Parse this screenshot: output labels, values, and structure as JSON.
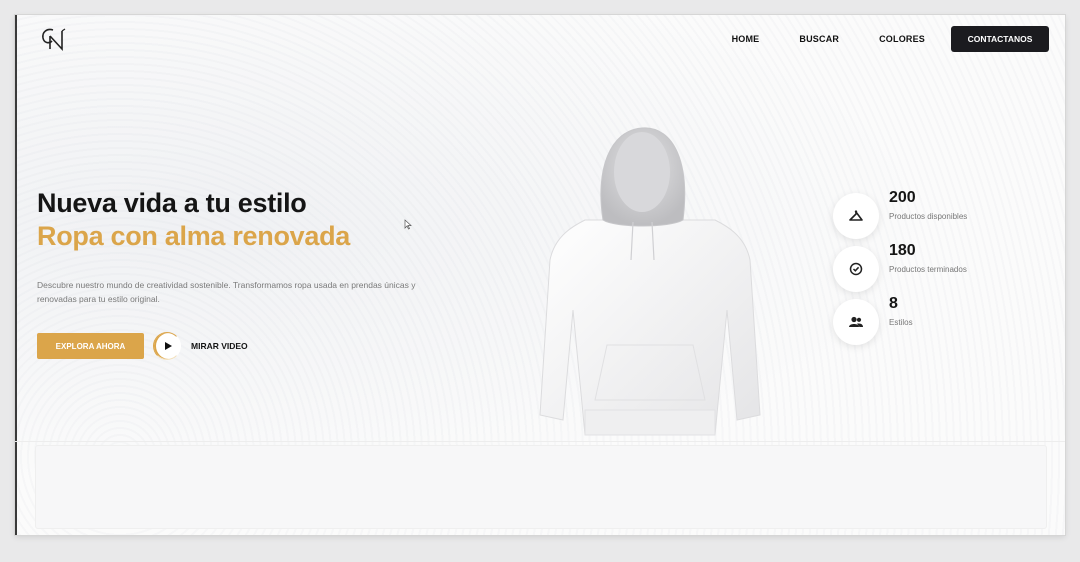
{
  "brand": {
    "logo_text": "CN"
  },
  "nav": {
    "links": [
      "HOME",
      "BUSCAR",
      "COLORES"
    ],
    "contact_label": "CONTACTANOS"
  },
  "hero": {
    "title_line1": "Nueva vida a tu estilo",
    "title_line2": "Ropa con alma renovada",
    "description": "Descubre nuestro mundo de creatividad sostenible. Transformamos ropa usada en prendas únicas y renovadas para tu estilo original.",
    "primary_button": "EXPLORA AHORA",
    "video_link": "MIRAR VIDEO"
  },
  "stats": [
    {
      "value": "200",
      "label": "Productos disponibles",
      "icon": "hanger-icon"
    },
    {
      "value": "180",
      "label": "Productos terminados",
      "icon": "check-circle-icon"
    },
    {
      "value": "8",
      "label": "Estilos",
      "icon": "users-icon"
    }
  ],
  "colors": {
    "accent": "#dba54a",
    "dark": "#1b1b1f",
    "background": "#fbfbfb"
  }
}
